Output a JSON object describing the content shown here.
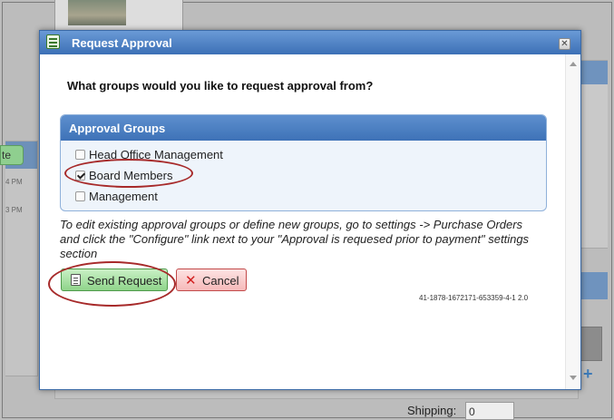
{
  "background": {
    "left_button_label": "te",
    "times": [
      "4 PM",
      "3 PM"
    ],
    "shipping_label": "Shipping:",
    "shipping_value": "0",
    "plus_icon": "plus-icon"
  },
  "dialog": {
    "title": "Request Approval",
    "title_icon": "form-icon",
    "close_icon": "close-icon",
    "question": "What groups would you like to request approval from?",
    "groups_header": "Approval Groups",
    "groups": [
      {
        "label": "Head Office Management",
        "checked": false
      },
      {
        "label": "Board Members",
        "checked": true
      },
      {
        "label": "Management",
        "checked": false
      }
    ],
    "hint": "To edit existing approval groups or define new groups, go to settings -> Purchase Orders and click the \"Configure\" link next to your \"Approval is requesed prior to payment\" settings section",
    "send_button": "Send Request",
    "cancel_button": "Cancel",
    "reference": "41-1878-1672171-653359-4-1 2.0"
  },
  "colors": {
    "title_bar": "#3c70b6",
    "send_button": "#8fd48a",
    "cancel_button": "#f6b9b9",
    "annotation": "#a72a2a"
  }
}
